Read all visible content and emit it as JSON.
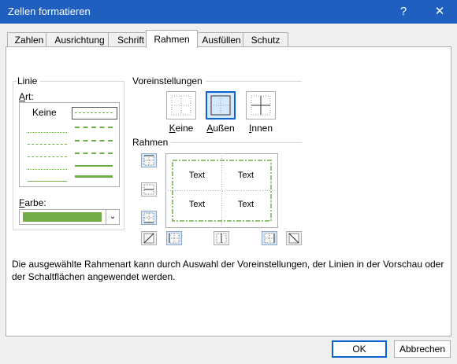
{
  "window": {
    "title": "Zellen formatieren",
    "help": "?",
    "close": "✕"
  },
  "tabs": [
    "Zahlen",
    "Ausrichtung",
    "Schrift",
    "Rahmen",
    "Ausfüllen",
    "Schutz"
  ],
  "active_tab": "Rahmen",
  "linie": {
    "group_label": "Linie",
    "art_label_u": "A",
    "art_label_rest": "rt:",
    "keine": "Keine",
    "farbe_label_u": "F",
    "farbe_label_rest": "arbe:",
    "farbe_color": "#70ad47"
  },
  "presets": {
    "group_label": "Voreinstellungen",
    "items": [
      {
        "u": "K",
        "rest": "eine"
      },
      {
        "u": "A",
        "rest": "ußen"
      },
      {
        "u": "I",
        "rest": "nnen"
      }
    ]
  },
  "rahmen": {
    "group_label": "Rahmen",
    "preview_text": [
      "Text",
      "Text",
      "Text",
      "Text"
    ],
    "border_color": "#70ad47"
  },
  "description": "Die ausgewählte Rahmenart kann durch Auswahl der Voreinstellungen, der Linien in der Vorschau oder der Schaltflächen angewendet werden.",
  "buttons": {
    "ok": "OK",
    "cancel": "Abbrechen"
  }
}
